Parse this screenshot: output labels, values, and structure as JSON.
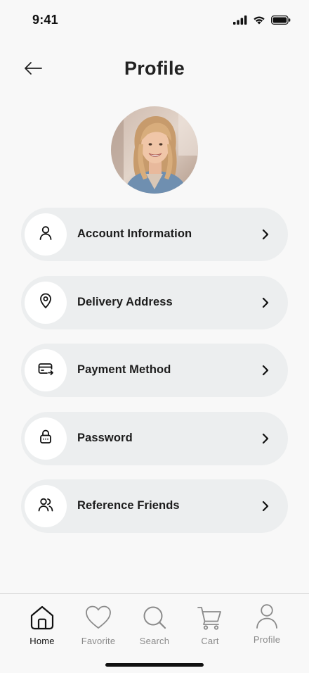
{
  "status_bar": {
    "time": "9:41"
  },
  "header": {
    "title": "Profile"
  },
  "menu": {
    "items": [
      {
        "label": "Account Information",
        "icon": "user-icon"
      },
      {
        "label": "Delivery Address",
        "icon": "location-pin-icon"
      },
      {
        "label": "Payment Method",
        "icon": "card-transfer-icon"
      },
      {
        "label": "Password",
        "icon": "lock-icon"
      },
      {
        "label": "Reference Friends",
        "icon": "users-icon"
      }
    ]
  },
  "bottom_nav": {
    "items": [
      {
        "label": "Home",
        "icon": "home-icon",
        "active": true
      },
      {
        "label": "Favorite",
        "icon": "heart-icon",
        "active": false
      },
      {
        "label": "Search",
        "icon": "search-icon",
        "active": false
      },
      {
        "label": "Cart",
        "icon": "cart-icon",
        "active": false
      },
      {
        "label": "Profile",
        "icon": "profile-icon",
        "active": false
      }
    ]
  },
  "colors": {
    "background": "#f8f8f8",
    "menu_item_bg": "#eceeef",
    "icon_circle_bg": "#ffffff",
    "text_primary": "#1c1c1c",
    "nav_inactive": "#8a8a8a"
  }
}
